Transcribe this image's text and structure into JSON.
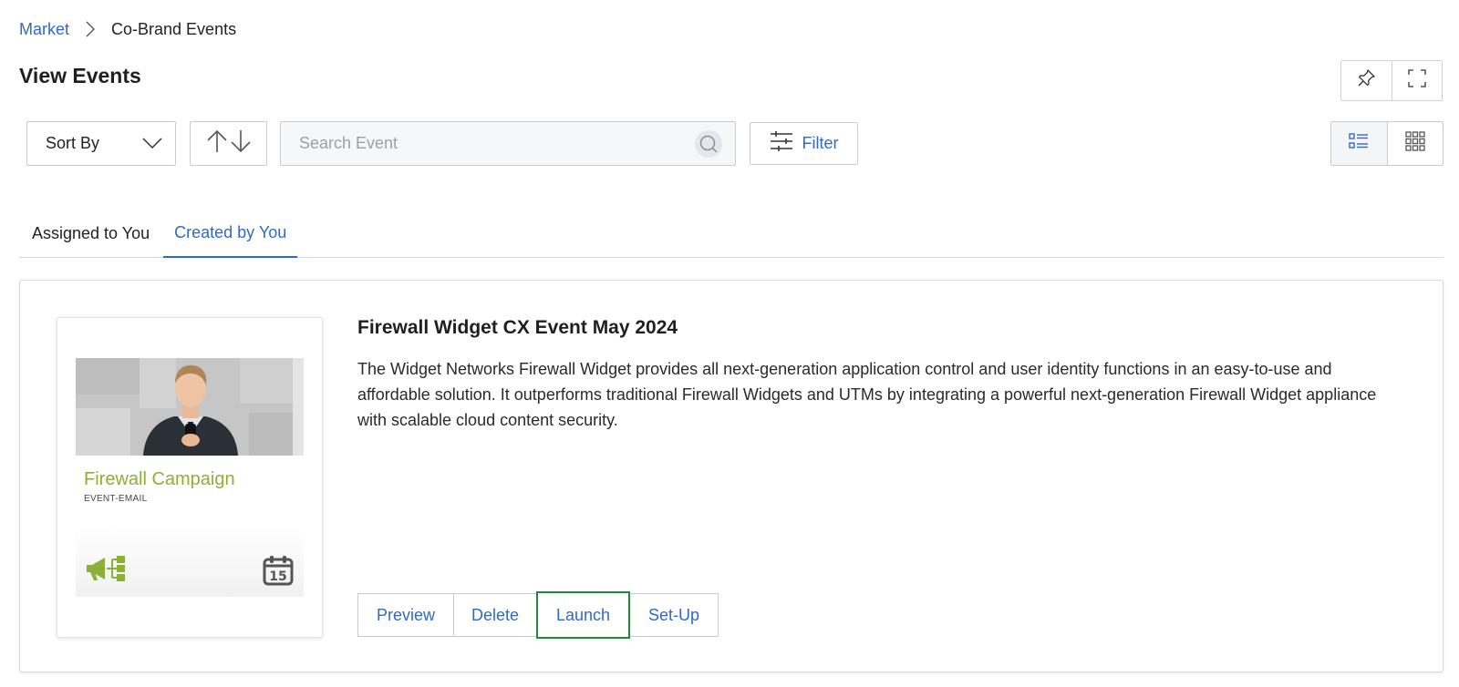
{
  "breadcrumb": {
    "root": "Market",
    "current": "Co-Brand Events"
  },
  "page": {
    "title": "View Events"
  },
  "toolbar": {
    "sort_label": "Sort By",
    "search_placeholder": "Search Event",
    "search_value": "",
    "filter_label": "Filter"
  },
  "tabs": [
    {
      "label": "Assigned to You",
      "active": false
    },
    {
      "label": "Created by You",
      "active": true
    }
  ],
  "event": {
    "title": "Firewall Widget CX Event May 2024",
    "description": "The Widget Networks Firewall Widget provides all next-generation application control and user identity functions in an easy-to-use and affordable solution. It outperforms traditional Firewall Widgets and UTMs by integrating a powerful next-generation Firewall Widget appliance with scalable cloud content security.",
    "thumbnail": {
      "title": "Firewall Campaign",
      "subtitle": "EVENT-EMAIL",
      "calendar_day": "15"
    },
    "actions": {
      "preview": "Preview",
      "delete": "Delete",
      "launch": "Launch",
      "setup": "Set-Up"
    }
  },
  "colors": {
    "link": "#2f6bc4",
    "brand_green": "#8cb038",
    "focus_border": "#1f8a3a",
    "border": "#c7ccd2"
  },
  "icons": {
    "breadcrumb_separator": "chevron-right-icon",
    "pin": "pin-icon",
    "fullscreen": "fullscreen-icon",
    "sort_dropdown": "chevron-down-icon",
    "sort_order": "sort-arrows-icon",
    "search": "search-icon",
    "filter": "sliders-icon",
    "list_view": "list-view-icon",
    "grid_view": "grid-view-icon",
    "megaphone": "megaphone-icon",
    "calendar": "calendar-icon"
  }
}
